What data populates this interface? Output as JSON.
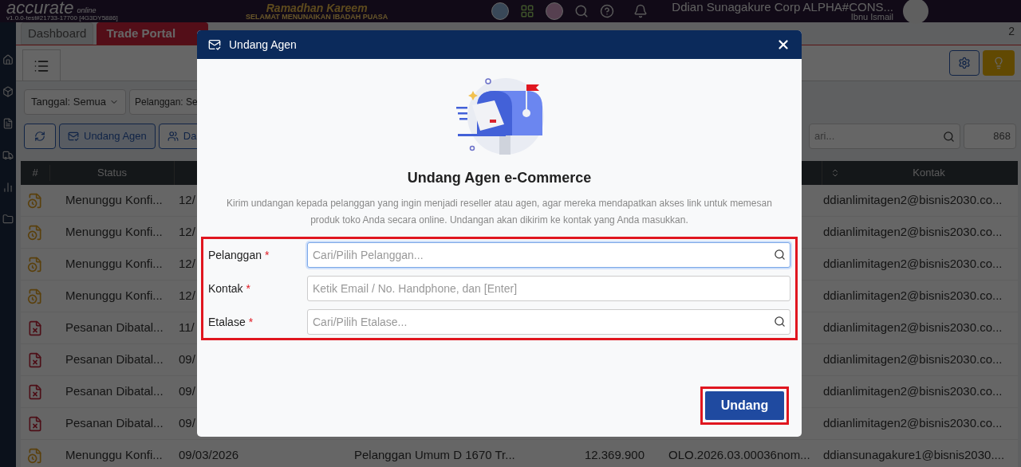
{
  "topbar": {
    "logo": "accurate",
    "logo_sub": "online",
    "version": "v1.0.0-test#21733-17700 [4G3DY5886]",
    "banner_title": "Ramadhan Kareem",
    "banner_subtitle": "SELAMAT MENUNAIKAN IBADAH PUASA",
    "company": "Ddian Sunagakure Corp ALPHA#CONS...",
    "user": "Ibnu Ismail"
  },
  "tabs": [
    {
      "label": "Dashboard",
      "selected": false
    },
    {
      "label": "Trade Portal",
      "selected": true
    }
  ],
  "tab_count": "2",
  "filters": [
    "Tanggal: Semua",
    "Pelanggan: Se"
  ],
  "actions": [
    "Undang Agen",
    "Da"
  ],
  "search": {
    "placeholder": "ari..."
  },
  "page_size": "868",
  "table": {
    "columns": [
      "#",
      "Status",
      "Kontak"
    ],
    "rows": [
      {
        "kind": "waiting",
        "status": "Menunggu Konfi...",
        "date": "12/",
        "kontak": "ddianlimitagen2@bisnis2030.co..."
      },
      {
        "kind": "waiting",
        "status": "Menunggu Konfi...",
        "date": "12/",
        "kontak": "ddianlimitagen2@bisnis2030.co..."
      },
      {
        "kind": "waiting",
        "status": "Menunggu Konfi...",
        "date": "12/",
        "kontak": "ddianlimitagen2@bisnis2030.co..."
      },
      {
        "kind": "waiting",
        "status": "Menunggu Konfi...",
        "date": "12/",
        "kontak": "ddianlimitagen2@bisnis2030.co..."
      },
      {
        "kind": "cancelled",
        "status": "Pesanan Dibatal...",
        "date": "11/",
        "kontak": "ddianlimitagen2@bisnis2030.co..."
      },
      {
        "kind": "cancelled",
        "status": "Pesanan Dibatal...",
        "date": "09/",
        "kontak": "ddianlimitagen2@bisnis2030.co..."
      },
      {
        "kind": "cancelled",
        "status": "Pesanan Dibatal...",
        "date": "09/",
        "kontak": "ddianlimitagen2@bisnis2030.co..."
      },
      {
        "kind": "cancelled",
        "status": "Pesanan Dibatal...",
        "date": "09/",
        "kontak": "ddianlimitagen2@bisnis2030.co..."
      },
      {
        "kind": "waiting",
        "status": "Menunggu Konfi...",
        "date": "09/03/2026",
        "customer": "Pelanggan Umum D 1670 Tr...",
        "amount": "12.369.900",
        "number": "OLO.2026.03.00036nom...",
        "kontak": "ddiansunagakure1@bisnis2030...."
      }
    ]
  },
  "dialog": {
    "title": "Undang Agen",
    "heading": "Undang Agen e-Commerce",
    "description": "Kirim undangan kepada pelanggan yang ingin menjadi reseller atau agen, agar mereka mendapatkan akses link untuk memesan produk toko Anda secara online. Undangan akan dikirim ke kontak yang Anda masukkan.",
    "fields": [
      {
        "label": "Pelanggan",
        "required_mark": "*",
        "placeholder": "Cari/Pilih Pelanggan...",
        "focused": true,
        "searchable": true
      },
      {
        "label": "Kontak",
        "required_mark": "*",
        "placeholder": "Ketik Email / No. Handphone, dan [Enter]",
        "focused": false,
        "searchable": false
      },
      {
        "label": "Etalase",
        "required_mark": "*",
        "placeholder": "Cari/Pilih Etalase...",
        "focused": false,
        "searchable": true
      }
    ],
    "submit": "Undang"
  }
}
